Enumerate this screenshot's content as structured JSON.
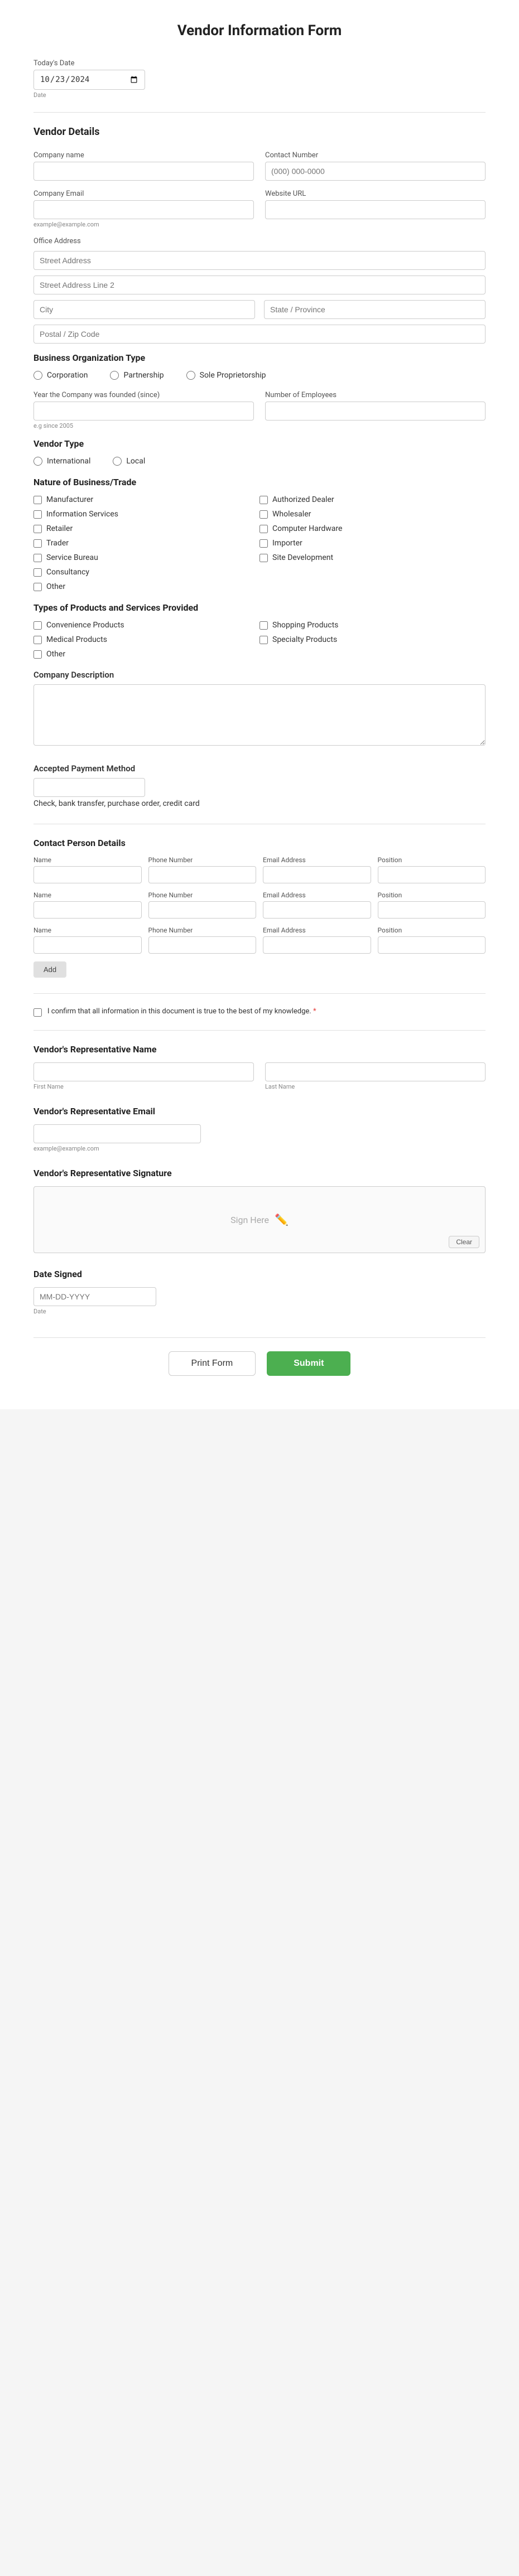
{
  "page": {
    "title": "Vendor Information Form"
  },
  "todays_date": {
    "label": "Today's Date",
    "value": "10-23-2024",
    "hint": "Date"
  },
  "vendor_details": {
    "title": "Vendor Details",
    "company_name": {
      "label": "Company name",
      "placeholder": ""
    },
    "contact_number": {
      "label": "Contact Number",
      "placeholder": "(000) 000-0000"
    },
    "company_email": {
      "label": "Company Email",
      "placeholder": "",
      "hint": "example@example.com"
    },
    "website_url": {
      "label": "Website URL",
      "placeholder": ""
    },
    "office_address": {
      "label": "Office Address",
      "street1": {
        "placeholder": "Street Address"
      },
      "street2": {
        "placeholder": "Street Address Line 2"
      },
      "city": {
        "placeholder": "City"
      },
      "state": {
        "placeholder": "State / Province"
      },
      "postal": {
        "placeholder": "Postal / Zip Code"
      }
    },
    "business_org": {
      "label": "Business Organization Type",
      "options": [
        "Corporation",
        "Partnership",
        "Sole Proprietorship"
      ]
    },
    "year_founded": {
      "label": "Year the Company was founded (since)",
      "placeholder": "",
      "hint": "e.g since 2005"
    },
    "num_employees": {
      "label": "Number of Employees",
      "placeholder": ""
    },
    "vendor_type": {
      "label": "Vendor Type",
      "options": [
        "International",
        "Local"
      ]
    },
    "nature_of_business": {
      "label": "Nature of Business/Trade",
      "col1": [
        "Manufacturer",
        "Information Services",
        "Retailer",
        "Trader",
        "Service Bureau",
        "Consultancy",
        "Other"
      ],
      "col2": [
        "Authorized Dealer",
        "Wholesaler",
        "Computer Hardware",
        "Importer",
        "Site Development"
      ]
    },
    "products_services": {
      "label": "Types of Products and Services Provided",
      "col1": [
        "Convenience Products",
        "Medical Products",
        "Other"
      ],
      "col2": [
        "Shopping Products",
        "Specialty Products"
      ]
    },
    "company_description": {
      "label": "Company Description"
    },
    "payment_method": {
      "label": "Accepted Payment Method",
      "placeholder": "",
      "hint": "Check, bank transfer, purchase order, credit card"
    }
  },
  "contact_persons": {
    "title": "Contact Person Details",
    "headers": [
      "Name",
      "Phone Number",
      "Email Address",
      "Position"
    ],
    "rows": 3,
    "add_btn": "Add"
  },
  "confirmation": {
    "text": "I confirm that all information in this document is true to the best of my knowledge.",
    "required_marker": "*"
  },
  "representative": {
    "name_label": "Vendor's Representative Name",
    "first_name": "First Name",
    "last_name": "Last Name",
    "email_label": "Vendor's Representative Email",
    "email_hint": "example@example.com",
    "signature_label": "Vendor's Representative Signature",
    "sign_here": "Sign Here",
    "clear_btn": "Clear",
    "date_signed_label": "Date Signed",
    "date_signed_placeholder": "MM-DD-YYYY",
    "date_hint": "Date"
  },
  "footer": {
    "print_label": "Print Form",
    "submit_label": "Submit"
  }
}
